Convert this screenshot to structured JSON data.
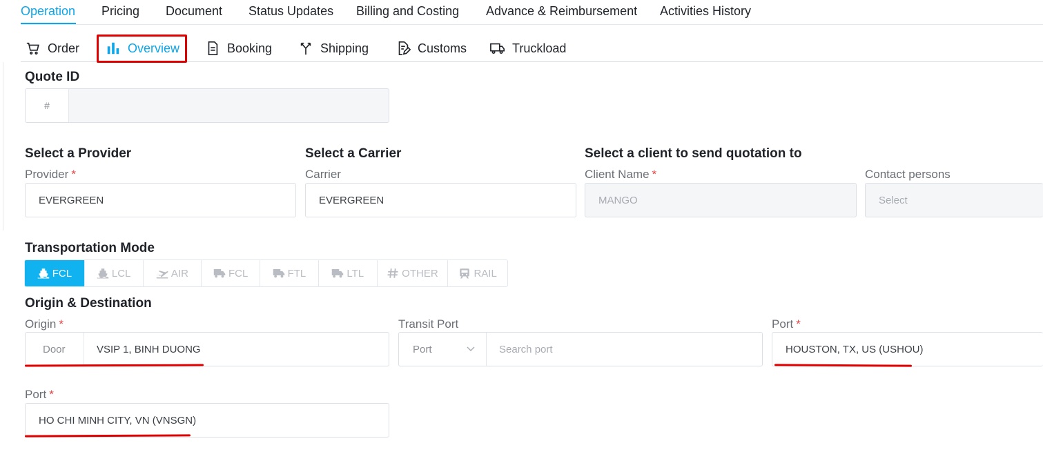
{
  "top_tabs": [
    "Operation",
    "Pricing",
    "Document",
    "Status Updates",
    "Billing and Costing",
    "Advance & Reimbursement",
    "Activities History"
  ],
  "sub_tabs": [
    {
      "label": "Order",
      "icon": "cart-icon"
    },
    {
      "label": "Overview",
      "icon": "bar-chart-icon"
    },
    {
      "label": "Booking",
      "icon": "document-icon"
    },
    {
      "label": "Shipping",
      "icon": "fork-icon"
    },
    {
      "label": "Customs",
      "icon": "edit-document-icon"
    },
    {
      "label": "Truckload",
      "icon": "truck-icon"
    }
  ],
  "quote": {
    "title": "Quote ID",
    "prefix": "#"
  },
  "provider": {
    "title": "Select a Provider",
    "label": "Provider",
    "value": "EVERGREEN"
  },
  "carrier": {
    "title": "Select a Carrier",
    "label": "Carrier",
    "value": "EVERGREEN"
  },
  "client": {
    "title": "Select a client to send quotation to",
    "label": "Client Name",
    "value": "MANGO"
  },
  "contact": {
    "label": "Contact persons",
    "placeholder": "Select"
  },
  "required_mark": "*",
  "transport": {
    "title": "Transportation Mode",
    "modes": [
      {
        "label": "FCL",
        "icon": "ship-icon",
        "active": true
      },
      {
        "label": "LCL",
        "icon": "ship-icon",
        "active": false
      },
      {
        "label": "AIR",
        "icon": "plane-icon",
        "active": false
      },
      {
        "label": "FCL",
        "icon": "truck-icon",
        "active": false
      },
      {
        "label": "FTL",
        "icon": "truck-icon",
        "active": false
      },
      {
        "label": "LTL",
        "icon": "truck-icon",
        "active": false
      },
      {
        "label": "OTHER",
        "icon": "hash-icon",
        "active": false
      },
      {
        "label": "RAIL",
        "icon": "train-icon",
        "active": false
      }
    ]
  },
  "route": {
    "title": "Origin & Destination",
    "origin": {
      "label": "Origin",
      "type": "Door",
      "value": "VSIP 1, BINH DUONG"
    },
    "transit": {
      "label": "Transit Port",
      "type": "Port",
      "placeholder": "Search port"
    },
    "destination_port": {
      "label": "Port",
      "value": "HOUSTON, TX, US (USHOU)"
    },
    "origin_port": {
      "label": "Port",
      "value": "HO CHI MINH CITY, VN (VNSGN)"
    }
  },
  "colors": {
    "accent": "#0ea5e9",
    "annotation": "#e00000",
    "required": "#e64545"
  }
}
